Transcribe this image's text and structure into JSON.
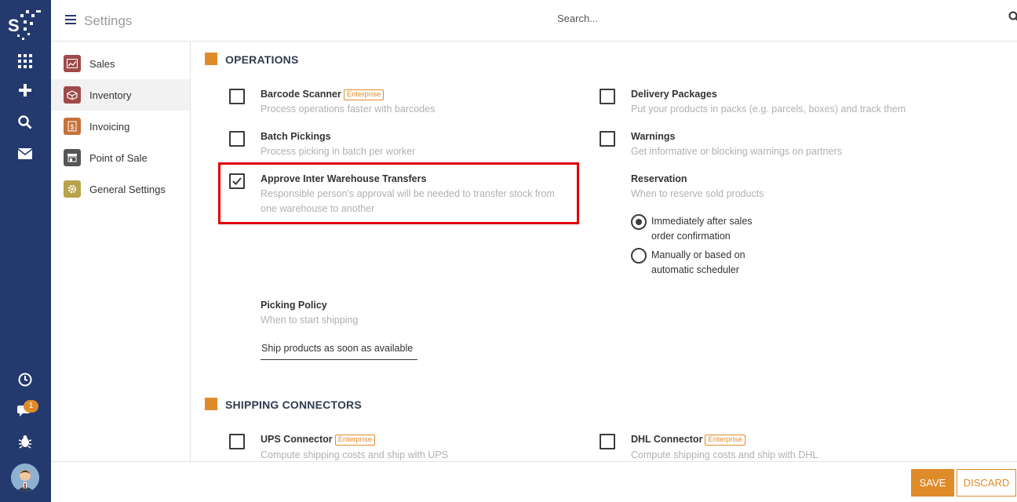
{
  "topbar": {
    "title": "Settings",
    "search_placeholder": "Search..."
  },
  "sidebar": {
    "items": [
      {
        "label": "Sales",
        "icon": "sales-chart-icon",
        "color": "#a04a4a"
      },
      {
        "label": "Inventory",
        "icon": "inventory-box-icon",
        "color": "#a04a4a"
      },
      {
        "label": "Invoicing",
        "icon": "invoice-dollar-icon",
        "color": "#c7703a"
      },
      {
        "label": "Point of Sale",
        "icon": "store-icon",
        "color": "#555555"
      },
      {
        "label": "General Settings",
        "icon": "gear-icon",
        "color": "#b8a24a"
      }
    ],
    "active": "Inventory"
  },
  "rail": {
    "notification_count": "1"
  },
  "operations": {
    "title": "OPERATIONS",
    "barcode": {
      "title": "Barcode Scanner",
      "badge": "Enterprise",
      "desc": "Process operations faster with barcodes",
      "checked": false
    },
    "batch": {
      "title": "Batch Pickings",
      "desc": "Process picking in batch per worker",
      "checked": false
    },
    "approve": {
      "title": "Approve Inter Warehouse Transfers",
      "desc1": "Responsible person's approval will be needed to transfer stock from",
      "desc2": "one warehouse to another",
      "checked": true
    },
    "delivery": {
      "title": "Delivery Packages",
      "desc": "Put your products in packs (e.g. parcels, boxes) and track them",
      "checked": false
    },
    "warnings": {
      "title": "Warnings",
      "desc": "Get informative or blocking warnings on partners",
      "checked": false
    },
    "reservation": {
      "title": "Reservation",
      "desc": "When to reserve sold products",
      "options": [
        {
          "line1": "Immediately after sales",
          "line2": "order confirmation",
          "selected": true
        },
        {
          "line1": "Manually or based on",
          "line2": "automatic scheduler",
          "selected": false
        }
      ]
    },
    "picking_policy": {
      "title": "Picking Policy",
      "desc": "When to start shipping",
      "value": "Ship products as soon as available"
    }
  },
  "shipping": {
    "title": "SHIPPING CONNECTORS",
    "ups": {
      "title": "UPS Connector",
      "badge": "Enterprise",
      "desc": "Compute shipping costs and ship with UPS",
      "checked": false
    },
    "dhl": {
      "title": "DHL Connector",
      "badge": "Enterprise",
      "desc": "Compute shipping costs and ship with DHL",
      "checked": false
    }
  },
  "footer": {
    "save_label": "SAVE",
    "discard_label": "DISCARD"
  },
  "colors": {
    "accent": "#e08b2a",
    "rail": "#243a6e",
    "highlight": "#e00000"
  }
}
